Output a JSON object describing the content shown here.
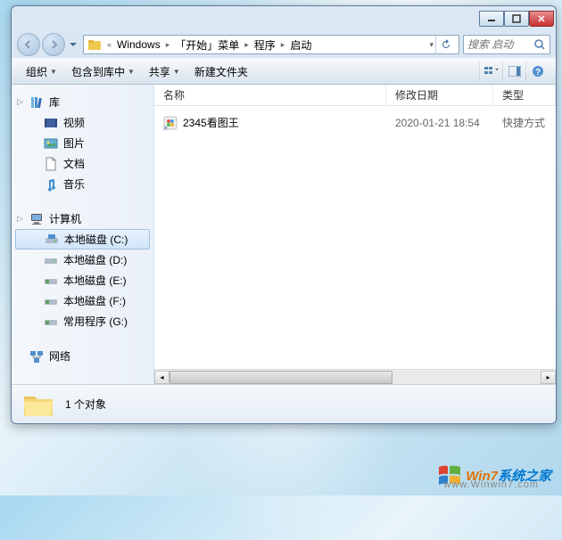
{
  "breadcrumb": {
    "segments": [
      "Windows",
      "「开始」菜单",
      "程序",
      "启动"
    ]
  },
  "search": {
    "placeholder": "搜索 启动"
  },
  "toolbar": {
    "organize": "组织",
    "include": "包含到库中",
    "share": "共享",
    "newfolder": "新建文件夹"
  },
  "columns": {
    "name": "名称",
    "modified": "修改日期",
    "type": "类型"
  },
  "sidebar": {
    "libraries": {
      "label": "库",
      "items": [
        {
          "label": "视频",
          "icon": "video"
        },
        {
          "label": "图片",
          "icon": "picture"
        },
        {
          "label": "文档",
          "icon": "document"
        },
        {
          "label": "音乐",
          "icon": "music"
        }
      ]
    },
    "computer": {
      "label": "计算机",
      "items": [
        {
          "label": "本地磁盘 (C:)",
          "icon": "sysdrive",
          "selected": true
        },
        {
          "label": "本地磁盘 (D:)",
          "icon": "drive"
        },
        {
          "label": "本地磁盘 (E:)",
          "icon": "drive2"
        },
        {
          "label": "本地磁盘 (F:)",
          "icon": "drive2"
        },
        {
          "label": "常用程序 (G:)",
          "icon": "drive2"
        }
      ]
    },
    "network": {
      "label": "网络"
    }
  },
  "files": [
    {
      "name": "2345看图王",
      "modified": "2020-01-21 18:54",
      "type": "快捷方式"
    }
  ],
  "status": {
    "count_label": "1 个对象"
  },
  "watermark": {
    "t1": "Win7",
    "t2": "系统之家",
    "sub": "www.Winwin7.com"
  }
}
